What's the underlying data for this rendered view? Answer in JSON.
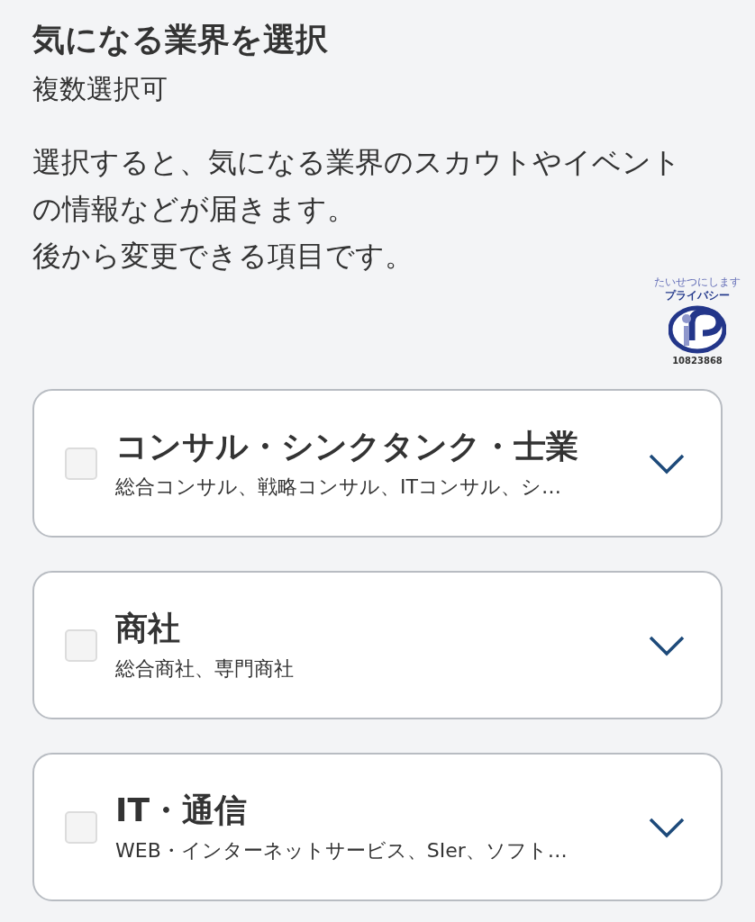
{
  "heading": {
    "title": "気になる業界を選択",
    "note": "複数選択可"
  },
  "description": [
    "選択すると、気になる業界のスカウトやイベント",
    "の情報などが届きます。",
    "後から変更できる項目です。"
  ],
  "privacy_mark": {
    "slogan": "たいせつにします",
    "word": "プライバシー",
    "number": "10823868"
  },
  "industries": [
    {
      "name": "コンサル・シンクタンク・士業",
      "examples": "総合コンサル、戦略コンサル、ITコンサル、シ…",
      "checked": false,
      "expanded": false
    },
    {
      "name": "商社",
      "examples": "総合商社、専門商社",
      "checked": false,
      "expanded": false
    },
    {
      "name": "IT・通信",
      "examples": "WEB・インターネットサービス、SIer、ソフト…",
      "checked": false,
      "expanded": false
    }
  ]
}
